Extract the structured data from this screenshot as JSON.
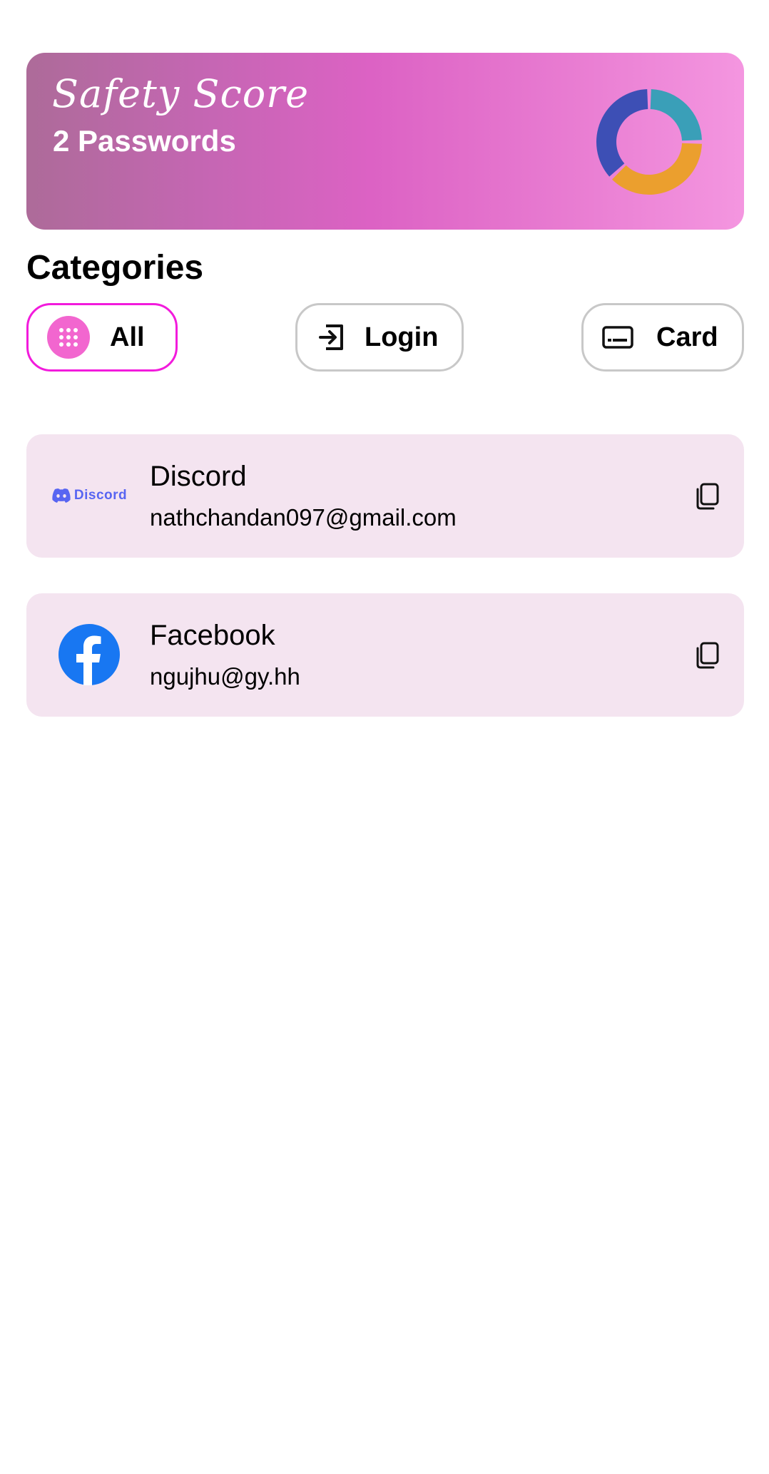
{
  "score_card": {
    "title": "Safety Score",
    "subtitle": "2 Passwords",
    "donut": {
      "segments": [
        {
          "color": "#3a9fb8",
          "fraction": 0.25
        },
        {
          "color": "#eb9f2e",
          "fraction": 0.38
        },
        {
          "color": "#3d4fb5",
          "fraction": 0.37
        }
      ]
    }
  },
  "categories": {
    "title": "Categories",
    "chips": [
      {
        "label": "All",
        "icon": "grid-dots-icon",
        "active": true
      },
      {
        "label": "Login",
        "icon": "login-icon",
        "active": false
      },
      {
        "label": "Card",
        "icon": "card-icon",
        "active": false
      }
    ]
  },
  "entries": [
    {
      "name": "Discord",
      "email": "nathchandan097@gmail.com",
      "logo": "discord-logo",
      "logo_text": "Discord"
    },
    {
      "name": "Facebook",
      "email": "ngujhu@gy.hh",
      "logo": "facebook-logo"
    }
  ],
  "colors": {
    "accent": "#f21bdc",
    "chip_active_icon_bg": "#f266cf",
    "entry_bg": "#f4e4f0",
    "facebook_blue": "#1877f2",
    "discord_blurple": "#5865f2"
  }
}
